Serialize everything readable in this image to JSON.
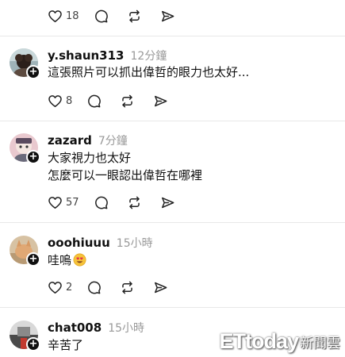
{
  "top_actions": {
    "like_count": "18"
  },
  "posts": [
    {
      "username": "y.shaun313",
      "time": "12分鐘",
      "lines": [
        "這張照片可以抓出偉哲的眼力也太好..."
      ],
      "like_count": "8"
    },
    {
      "username": "zazard",
      "time": "7分鐘",
      "lines": [
        "大家視力也太好",
        "怎麼可以一眼認出偉哲在哪裡"
      ],
      "like_count": "57"
    },
    {
      "username": "ooohiuuu",
      "time": "15小時",
      "lines": [
        "哇嗚"
      ],
      "like_count": "2"
    },
    {
      "username": "chat008",
      "time": "15小時",
      "lines": [
        "辛苦了"
      ]
    }
  ],
  "watermark": {
    "brand": "ETtoday",
    "suffix": "新聞雲"
  },
  "icons": {
    "like": "heart-icon",
    "reply": "comment-icon",
    "repost": "repost-icon",
    "share": "share-icon",
    "follow": "plus-icon",
    "emoji": "smiling-face-with-heart-eyes"
  }
}
